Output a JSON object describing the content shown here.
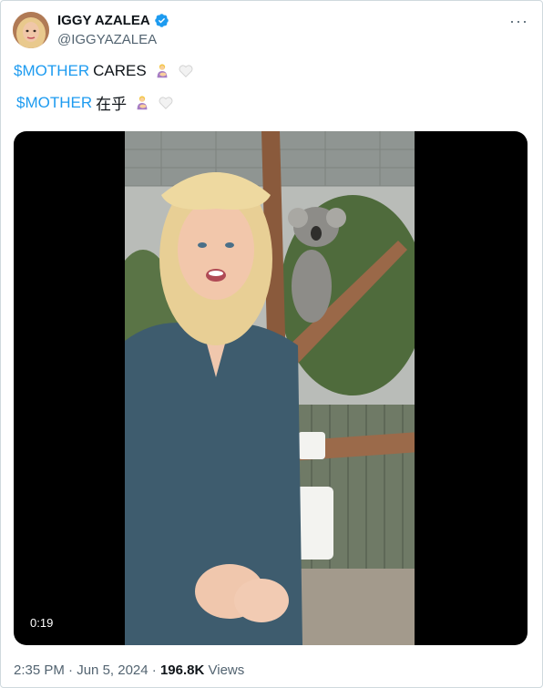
{
  "user": {
    "name": "IGGY AZALEA",
    "handle": "@IGGYAZALEA",
    "verified_color": "#1d9bf0"
  },
  "tweet": {
    "line1": {
      "cashtag": "$MOTHER",
      "text": "CARES"
    },
    "line2": {
      "cashtag": "$MOTHER",
      "text": "在乎"
    },
    "emojis": [
      "woman-feeding-baby-emoji",
      "white-heart-emoji"
    ]
  },
  "video": {
    "duration": "0:19"
  },
  "meta": {
    "time": "2:35 PM",
    "separator": "·",
    "date": "Jun 5, 2024",
    "views_count": "196.8K",
    "views_label": "Views"
  },
  "more_icon": "···",
  "colors": {
    "accent": "#1d9bf0",
    "muted": "#536471",
    "text": "#0f1419"
  }
}
